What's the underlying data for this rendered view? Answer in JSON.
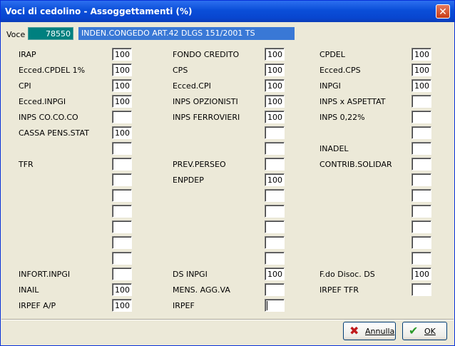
{
  "window": {
    "title": "Voci di cedolino - Assoggettamenti (%)",
    "close_glyph": "✕"
  },
  "voce": {
    "label": "Voce",
    "code": "78550",
    "description": "INDEN.CONGEDO ART.42 DLGS 151/2001 TS"
  },
  "col1": {
    "labels": [
      "IRAP",
      "Ecced.CPDEL 1%",
      "CPI",
      "Ecced.INPGI",
      "INPS CO.CO.CO",
      "CASSA PENS.STAT",
      "",
      "TFR",
      "",
      "",
      "",
      "",
      "",
      "",
      "INFORT.INPGI",
      "INAIL",
      "IRPEF A/P"
    ],
    "values": [
      "100",
      "100",
      "100",
      "100",
      "",
      "100",
      "",
      "",
      "",
      "",
      "",
      "",
      "",
      "",
      "",
      "100",
      "100"
    ]
  },
  "col2": {
    "labels": [
      "FONDO CREDITO",
      "CPS",
      "Ecced.CPI",
      "INPS OPZIONISTI",
      "INPS FERROVIERI",
      "",
      "",
      "PREV.PERSEO",
      "ENPDEP",
      "",
      "",
      "",
      "",
      "",
      "DS INPGI",
      "MENS. AGG.VA",
      "IRPEF"
    ],
    "values": [
      "100",
      "100",
      "100",
      "100",
      "100",
      "",
      "",
      "",
      "100",
      "",
      "",
      "",
      "",
      "",
      "100",
      "",
      ""
    ]
  },
  "col3": {
    "labels": [
      "CPDEL",
      "Ecced.CPS",
      "INPGI",
      "INPS x ASPETTAT",
      "INPS 0,22%",
      "",
      "INADEL",
      "CONTRIB.SOLIDAR",
      "",
      "",
      "",
      "",
      "",
      "",
      "F.do Disoc. DS",
      "IRPEF TFR"
    ],
    "values": [
      "100",
      "100",
      "100",
      "",
      "",
      "",
      "",
      "",
      "",
      "",
      "",
      "",
      "",
      "",
      "100",
      ""
    ]
  },
  "buttons": {
    "cancel_label": "Annulla",
    "cancel_icon": "✖",
    "ok_label": "OK",
    "ok_icon": "✔"
  },
  "colors": {
    "titlebar": "#0a4ed8",
    "code_bg": "#00807f",
    "desc_bg": "#3978d6",
    "cancel_icon": "#c0191b",
    "ok_icon": "#2a9a2a"
  }
}
